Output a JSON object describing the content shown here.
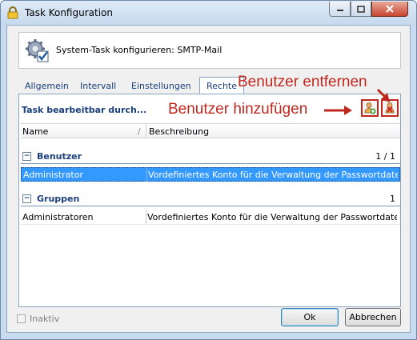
{
  "window": {
    "title": "Task Konfiguration",
    "minimize_icon": "minimize-icon",
    "maximize_icon": "maximize-icon",
    "close_icon": "close-icon"
  },
  "header": {
    "text": "System-Task konfigurieren: SMTP-Mail",
    "icon": "gear-check-icon"
  },
  "tabs": [
    {
      "label": "Allgemein",
      "active": false
    },
    {
      "label": "Intervall",
      "active": false
    },
    {
      "label": "Einstellungen",
      "active": false
    },
    {
      "label": "Rechte",
      "active": true
    }
  ],
  "rights": {
    "section_title": "Task bearbeitbar durch...",
    "add_user_icon": "add-user-icon",
    "remove_user_icon": "remove-user-icon",
    "columns": {
      "name": "Name",
      "description": "Beschreibung",
      "sort_indicator": "/"
    },
    "groups": [
      {
        "label": "Benutzer",
        "collapse_symbol": "−",
        "count": "1 / 1",
        "rows": [
          {
            "name": "Administrator",
            "description": "Vordefiniertes Konto für die Verwaltung der Passwortdatenbai",
            "selected": true
          }
        ]
      },
      {
        "label": "Gruppen",
        "collapse_symbol": "−",
        "count": "1",
        "rows": [
          {
            "name": "Administratoren",
            "description": "Vordefiniertes Konto für die Verwaltung der Passwortdatenbai",
            "selected": false
          }
        ]
      }
    ]
  },
  "annotations": {
    "remove_label": "Benutzer entfernen",
    "add_label": "Benutzer hinzufügen",
    "color": "#c0281f"
  },
  "footer": {
    "inactive_label": "Inaktiv",
    "inactive_checked": false,
    "ok_label": "Ok",
    "cancel_label": "Abbrechen"
  },
  "colors": {
    "selection": "#3399ff",
    "group_text": "#1a3f7a",
    "accent_red": "#c0281f"
  }
}
